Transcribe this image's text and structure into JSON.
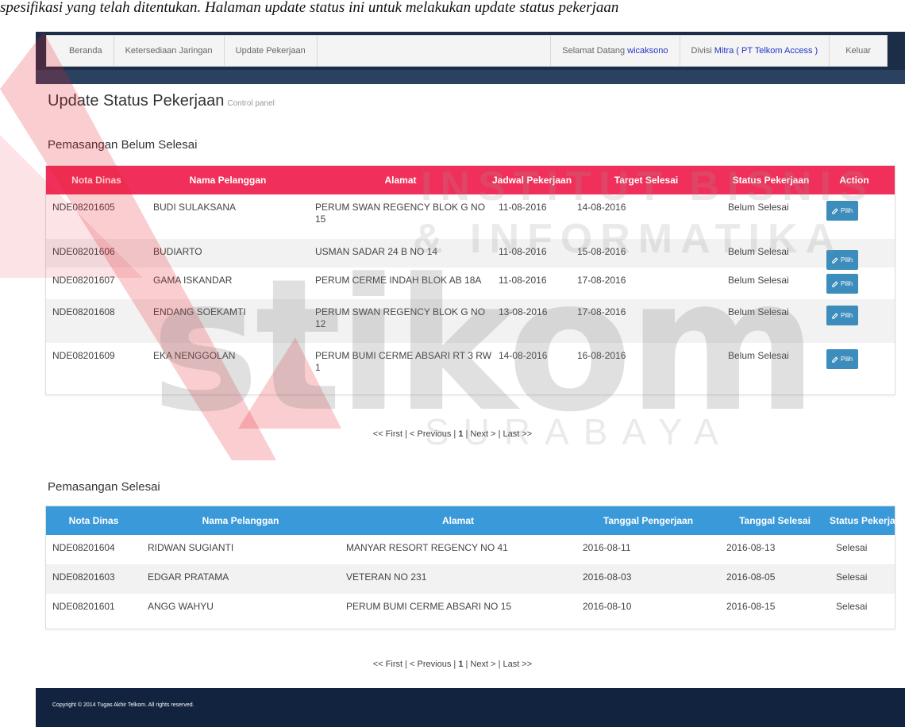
{
  "doc_text": "spesifikasi yang telah ditentukan. Halaman update status ini untuk melakukan update status pekerjaan",
  "nav": {
    "home": "Beranda",
    "availability": "Ketersediaan Jaringan",
    "update": "Update Pekerjaan",
    "welcome_label": "Selamat Datang",
    "username": "wicaksono",
    "division_label": "Divisi",
    "division_value": "Mitra ( PT Telkom Access )",
    "logout": "Keluar"
  },
  "page": {
    "title": "Update Status Pekerjaan",
    "subtitle": "Control panel"
  },
  "pending": {
    "title": "Pemasangan Belum Selesai",
    "header_color": "#f0305a",
    "headers": [
      "Nota Dinas",
      "Nama Pelanggan",
      "Alamat",
      "Jadwal Pekerjaan",
      "Target Selesai",
      "Status Pekerjaan",
      "Action"
    ],
    "action_label": "Pilih",
    "rows": [
      {
        "nota": "NDE08201605",
        "nama": "BUDI SULAKSANA",
        "alamat": "PERUM SWAN REGENCY BLOK G NO 15",
        "jadwal": "11-08-2016",
        "target": "14-08-2016",
        "status": "Belum Selesai"
      },
      {
        "nota": "NDE08201606",
        "nama": "BUDIARTO",
        "alamat": "USMAN SADAR 24 B NO 14",
        "jadwal": "11-08-2016",
        "target": "15-08-2016",
        "status": "Belum Selesai"
      },
      {
        "nota": "NDE08201607",
        "nama": "GAMA ISKANDAR",
        "alamat": "PERUM CERME INDAH BLOK AB 18A",
        "jadwal": "11-08-2016",
        "target": "17-08-2016",
        "status": "Belum Selesai"
      },
      {
        "nota": "NDE08201608",
        "nama": "ENDANG SOEKAMTI",
        "alamat": "PERUM SWAN REGENCY BLOK G NO 12",
        "jadwal": "13-08-2016",
        "target": "17-08-2016",
        "status": "Belum Selesai"
      },
      {
        "nota": "NDE08201609",
        "nama": "EKA NENGGOLAN",
        "alamat": "PERUM BUMI CERME ABSARI RT 3 RW 1",
        "jadwal": "14-08-2016",
        "target": "16-08-2016",
        "status": "Belum Selesai"
      }
    ]
  },
  "pager": {
    "first": "<< First",
    "previous": "< Previous",
    "current": "1",
    "next": "Next >",
    "last": "Last >>",
    "sep": "|"
  },
  "done": {
    "title": "Pemasangan Selesai",
    "header_color": "#3a9ad9",
    "headers": [
      "Nota Dinas",
      "Nama Pelanggan",
      "Alamat",
      "Tanggal Pengerjaan",
      "Tanggal Selesai",
      "Status Pekerjaan"
    ],
    "rows": [
      {
        "nota": "NDE08201604",
        "nama": "RIDWAN SUGIANTI",
        "alamat": "MANYAR RESORT REGENCY NO 41",
        "tgl_kerja": "2016-08-11",
        "tgl_selesai": "2016-08-13",
        "status": "Selesai"
      },
      {
        "nota": "NDE08201603",
        "nama": "EDGAR PRATAMA",
        "alamat": "VETERAN NO 231",
        "tgl_kerja": "2016-08-03",
        "tgl_selesai": "2016-08-05",
        "status": "Selesai"
      },
      {
        "nota": "NDE08201601",
        "nama": "ANGG WAHYU",
        "alamat": "PERUM BUMI CERME ABSARI NO 15",
        "tgl_kerja": "2016-08-10",
        "tgl_selesai": "2016-08-15",
        "status": "Selesai"
      }
    ]
  },
  "footer": {
    "text": "Copyright © 2014 Tugas Akhir Telkom. All rights reserved."
  },
  "watermark": {
    "line1": "INSTITUT BISNIS",
    "line2": "& INFORMATIKA",
    "logo": "stikom",
    "line3": "SURABAYA",
    "red": "#e8202f"
  }
}
